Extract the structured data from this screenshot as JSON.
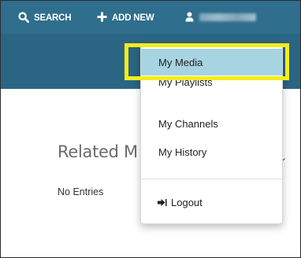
{
  "topbar": {
    "search_label": "SEARCH",
    "add_new_label": "ADD NEW"
  },
  "icons": {
    "search": "search-icon",
    "add": "plus-icon",
    "user": "user-icon",
    "logout": "logout-icon"
  },
  "user_menu": {
    "items": [
      {
        "label": "My Media",
        "highlighted": true
      },
      {
        "label": "My Playlists"
      },
      {
        "label": "My Channels"
      },
      {
        "label": "My History"
      }
    ],
    "logout_label": "Logout"
  },
  "main": {
    "related_title": "Related M",
    "no_entries": "No Entries",
    "chevron": "⌄"
  },
  "colors": {
    "topbar": "#2f6e8d",
    "highlight_item": "#a7d4e1",
    "annotation": "#f4ec1c"
  }
}
